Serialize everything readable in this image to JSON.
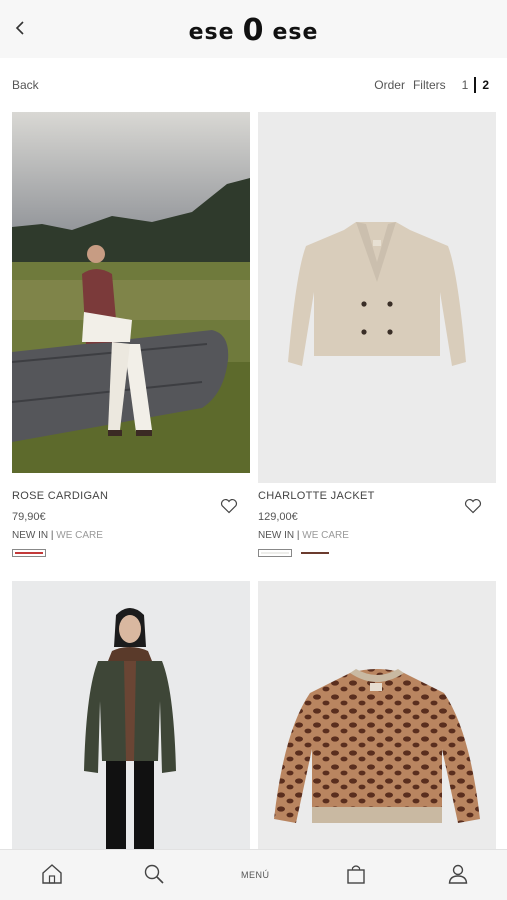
{
  "header": {
    "logo_left": "ese",
    "logo_mid": "0",
    "logo_right": "ese"
  },
  "toolbar": {
    "back": "Back",
    "order": "Order",
    "filters": "Filters",
    "page1": "1",
    "page2": "2"
  },
  "products": [
    {
      "name": "ROSE CARDIGAN",
      "price": "79,90€",
      "tag_new": "NEW IN",
      "tag_sep": " | ",
      "tag_care": "WE CARE",
      "swatch_colors": [
        "#c33a3a"
      ]
    },
    {
      "name": "CHARLOTTE JACKET",
      "price": "129,00€",
      "tag_new": "NEW IN",
      "tag_sep": " | ",
      "tag_care": "WE CARE",
      "swatch_colors": [
        "#ededea",
        "#6b3b2e"
      ]
    },
    {
      "name": "",
      "price": ""
    },
    {
      "name": "",
      "price": ""
    }
  ],
  "bottom_nav": {
    "menu": "MENÚ"
  },
  "icons": [
    "chevron-left-icon",
    "heart-icon",
    "home-icon",
    "search-icon",
    "bag-icon",
    "user-icon"
  ],
  "colors": {
    "header_bg": "#f7f7f7",
    "image_bg": "#e8e8e8",
    "text": "#333333"
  }
}
